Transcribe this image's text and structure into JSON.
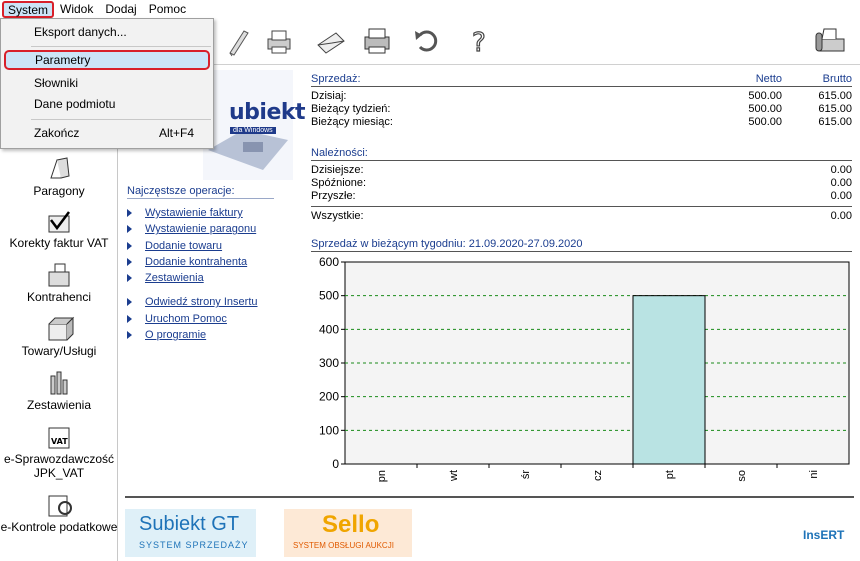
{
  "menubar": {
    "items": [
      {
        "label": "System",
        "active": true
      },
      {
        "label": "Widok"
      },
      {
        "label": "Dodaj"
      },
      {
        "label": "Pomoc"
      }
    ]
  },
  "system_menu": {
    "items": [
      {
        "label": "Eksport danych...",
        "shortcut": ""
      },
      {
        "label": "Parametry",
        "shortcut": "",
        "selected": true
      },
      {
        "label": "Słowniki",
        "shortcut": ""
      },
      {
        "label": "Dane podmiotu",
        "shortcut": ""
      },
      {
        "label": "Zakończ",
        "shortcut": "Alt+F4"
      }
    ]
  },
  "toolbar": {
    "icons": [
      "pen-icon",
      "printer-icon",
      "envelope-icon",
      "printer-alt-icon",
      "refresh-icon",
      "help-icon",
      "fax-icon"
    ]
  },
  "leftnav": {
    "items": [
      {
        "label": "Paragony",
        "icon": "receipt-icon"
      },
      {
        "label": "Korekty faktur VAT",
        "icon": "correction-icon"
      },
      {
        "label": "Kontrahenci",
        "icon": "contractors-icon"
      },
      {
        "label": "Towary/Usługi",
        "icon": "goods-icon"
      },
      {
        "label": "Zestawienia",
        "icon": "reports-icon"
      },
      {
        "label": "e-Sprawozdawczość JPK_VAT",
        "icon": "vat-icon"
      },
      {
        "label": "e-Kontrole podatkowe",
        "icon": "tax-control-icon"
      }
    ]
  },
  "logo": {
    "name": "ubiekt",
    "sub": "dla Windows"
  },
  "operations": {
    "title": "Najczęstsze operacje:",
    "links": [
      "Wystawienie faktury",
      "Wystawienie paragonu",
      "Dodanie towaru",
      "Dodanie kontrahenta",
      "Zestawienia",
      "Odwiedź strony Insertu",
      "Uruchom Pomoc",
      "O programie"
    ]
  },
  "sales": {
    "title": "Sprzedaż:",
    "col_netto": "Netto",
    "col_brutto": "Brutto",
    "rows": [
      {
        "label": "Dzisiaj:",
        "netto": "500.00",
        "brutto": "615.00"
      },
      {
        "label": "Bieżący tydzień:",
        "netto": "500.00",
        "brutto": "615.00"
      },
      {
        "label": "Bieżący miesiąc:",
        "netto": "500.00",
        "brutto": "615.00"
      }
    ]
  },
  "receivables": {
    "title": "Należności:",
    "rows": [
      {
        "label": "Dzisiejsze:",
        "value": "0.00"
      },
      {
        "label": "Spóźnione:",
        "value": "0.00"
      },
      {
        "label": "Przyszłe:",
        "value": "0.00"
      }
    ],
    "total_label": "Wszystkie:",
    "total_value": "0.00"
  },
  "chart_data": {
    "type": "bar",
    "title": "Sprzedaż w bieżącym tygodniu: 21.09.2020-27.09.2020",
    "categories": [
      "pn",
      "wt",
      "śr",
      "cz",
      "pt",
      "so",
      "ni"
    ],
    "values": [
      0,
      0,
      0,
      0,
      500,
      0,
      0
    ],
    "ylim": [
      0,
      600
    ],
    "yticks": [
      0,
      100,
      200,
      300,
      400,
      500,
      600
    ],
    "grid": true,
    "bar_color": "#b9e3e3"
  },
  "footer": {
    "gt_name": "Subiekt GT",
    "gt_tag": "SYSTEM SPRZEDAŻY",
    "sello_name": "Sello",
    "sello_tag": "SYSTEM OBSŁUGI AUKCJI",
    "insert": "InsERT"
  }
}
